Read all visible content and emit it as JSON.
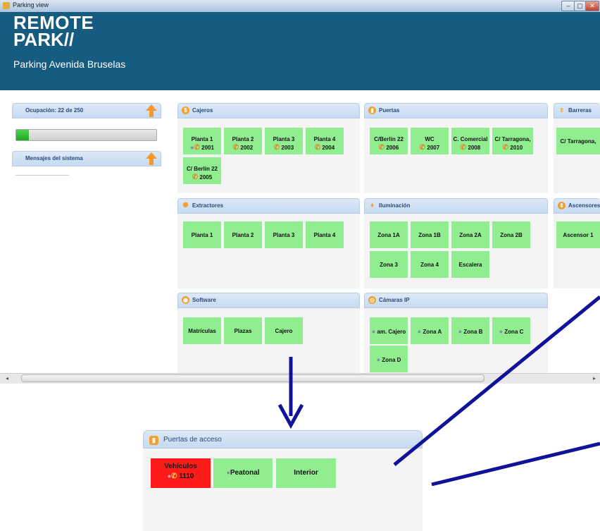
{
  "window": {
    "title": "Parking view",
    "min": "–",
    "max": "▢",
    "close": "✕"
  },
  "header": {
    "logo_line1": "REMOTE",
    "logo_line2": "PARK//",
    "subtitle": "Parking Avenida Bruselas"
  },
  "sidebar": {
    "occupancy_label": "Ocupación: 22 de 250",
    "occupancy_fraction": 0.088,
    "messages_label": "Mensajes del sistema"
  },
  "panels": {
    "cajeros": {
      "title": "Cajeros",
      "tiles": [
        {
          "line1": "Planta 1",
          "line2": "2001"
        },
        {
          "line1": "Planta 2",
          "line2": "2002"
        },
        {
          "line1": "Planta 3",
          "line2": "2003"
        },
        {
          "line1": "Planta 4",
          "line2": "2004"
        },
        {
          "line1": "C/ Berlín 22",
          "line2": "2005"
        }
      ]
    },
    "puertas": {
      "title": "Puertas",
      "tiles": [
        {
          "line1": "C/Berlín 22",
          "line2": "2006"
        },
        {
          "line1": "WC",
          "line2": "2007"
        },
        {
          "line1": "C. Comercial",
          "line2": "2008"
        },
        {
          "line1": "C/ Tarragona,",
          "line2": "2010"
        }
      ]
    },
    "barreras": {
      "title": "Barreras",
      "tiles": [
        {
          "label": "C/ Tarragona,"
        }
      ]
    },
    "extractores": {
      "title": "Extractores",
      "tiles": [
        {
          "label": "Planta 1"
        },
        {
          "label": "Planta 2"
        },
        {
          "label": "Planta 3"
        },
        {
          "label": "Planta 4"
        }
      ]
    },
    "iluminacion": {
      "title": "Iluminación",
      "tiles": [
        {
          "label": "Zona 1A"
        },
        {
          "label": "Zona 1B"
        },
        {
          "label": "Zona 2A"
        },
        {
          "label": "Zona 2B"
        },
        {
          "label": "Zona 3"
        },
        {
          "label": "Zona 4"
        },
        {
          "label": "Escalera"
        }
      ]
    },
    "ascensores": {
      "title": "Ascensores",
      "tiles": [
        {
          "label": "Ascensor 1"
        }
      ]
    },
    "software": {
      "title": "Software",
      "tiles": [
        {
          "label": "Matrículas"
        },
        {
          "label": "Plazas"
        },
        {
          "label": "Cajero"
        }
      ]
    },
    "camaras": {
      "title": "Cámaras IP",
      "tiles": [
        {
          "label": "am. Cajero"
        },
        {
          "label": "Zona A"
        },
        {
          "label": "Zona B"
        },
        {
          "label": "Zona C"
        },
        {
          "label": "Zona D"
        }
      ]
    }
  },
  "detail": {
    "title": "Puertas de acceso",
    "tiles": [
      {
        "line1": "Vehículos",
        "line2": "1110",
        "color": "#ff1a1a"
      },
      {
        "label": "Peatonal",
        "color": "#90ee90"
      },
      {
        "label": "Interior",
        "color": "#90ee90"
      }
    ]
  },
  "colors": {
    "header": "#165b80",
    "tile_ok": "#90ee90",
    "tile_alarm": "#ff1a1a",
    "arrow": "#10139a"
  }
}
